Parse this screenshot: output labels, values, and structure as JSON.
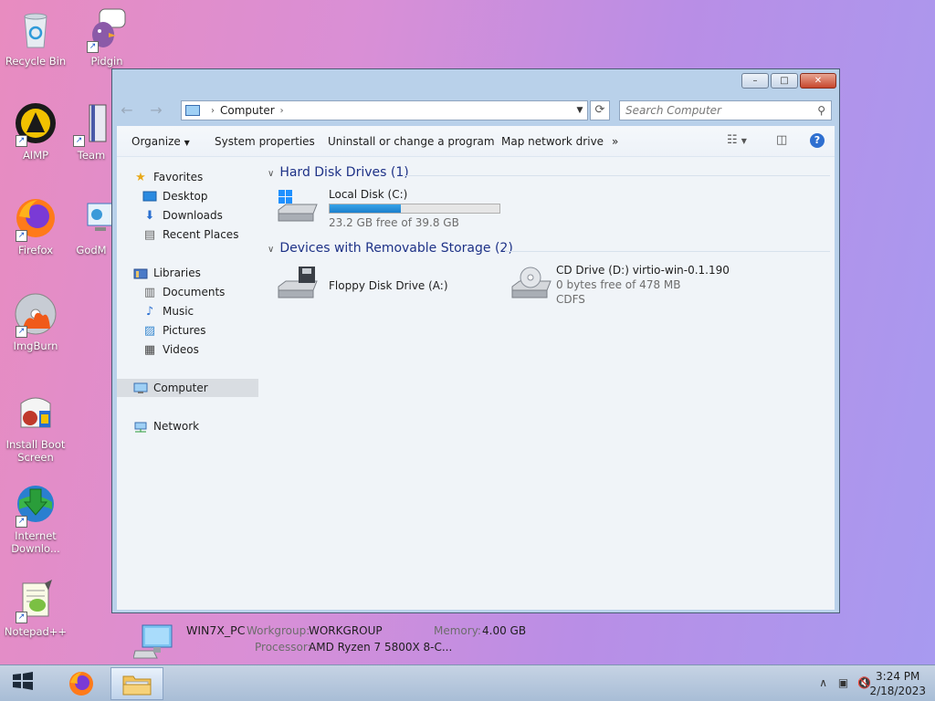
{
  "desktop": {
    "icons": [
      {
        "label": "Recycle Bin"
      },
      {
        "label": "Pidgin"
      },
      {
        "label": "AIMP"
      },
      {
        "label": "Team"
      },
      {
        "label": "Firefox"
      },
      {
        "label": "GodM"
      },
      {
        "label": "ImgBurn"
      },
      {
        "label": "Install Boot Screen"
      },
      {
        "label": "Internet Downlo..."
      },
      {
        "label": "Notepad++"
      }
    ]
  },
  "window": {
    "caption": {
      "minimize": "–",
      "maximize": "□",
      "close": "✕"
    },
    "address": {
      "location": "Computer"
    },
    "search": {
      "placeholder": "Search Computer"
    },
    "toolbar": {
      "organize": "Organize",
      "system_properties": "System properties",
      "uninstall": "Uninstall or change a program",
      "map_drive": "Map network drive",
      "more": "»"
    },
    "nav": {
      "favorites": "Favorites",
      "desktop": "Desktop",
      "downloads": "Downloads",
      "recent": "Recent Places",
      "libraries": "Libraries",
      "documents": "Documents",
      "music": "Music",
      "pictures": "Pictures",
      "videos": "Videos",
      "computer": "Computer",
      "network": "Network"
    },
    "groups": {
      "hdd": {
        "title": "Hard Disk Drives (1)",
        "drives": [
          {
            "name": "Local Disk (C:)",
            "free": "23.2 GB free of 39.8 GB",
            "used_fraction": 0.42
          }
        ]
      },
      "removable": {
        "title": "Devices with Removable Storage (2)",
        "drives": [
          {
            "name": "Floppy Disk Drive (A:)"
          },
          {
            "name": "CD Drive (D:) virtio-win-0.1.190",
            "free": "0 bytes free of 478 MB",
            "fs": "CDFS"
          }
        ]
      }
    },
    "details": {
      "pc_name": "WIN7X_PC",
      "workgroup_label": "Workgroup:",
      "workgroup": "WORKGROUP",
      "memory_label": "Memory:",
      "memory": "4.00 GB",
      "processor_label": "Processor:",
      "processor": "AMD Ryzen 7 5800X 8-C..."
    }
  },
  "taskbar": {
    "clock_time": "3:24 PM",
    "clock_date": "2/18/2023"
  }
}
